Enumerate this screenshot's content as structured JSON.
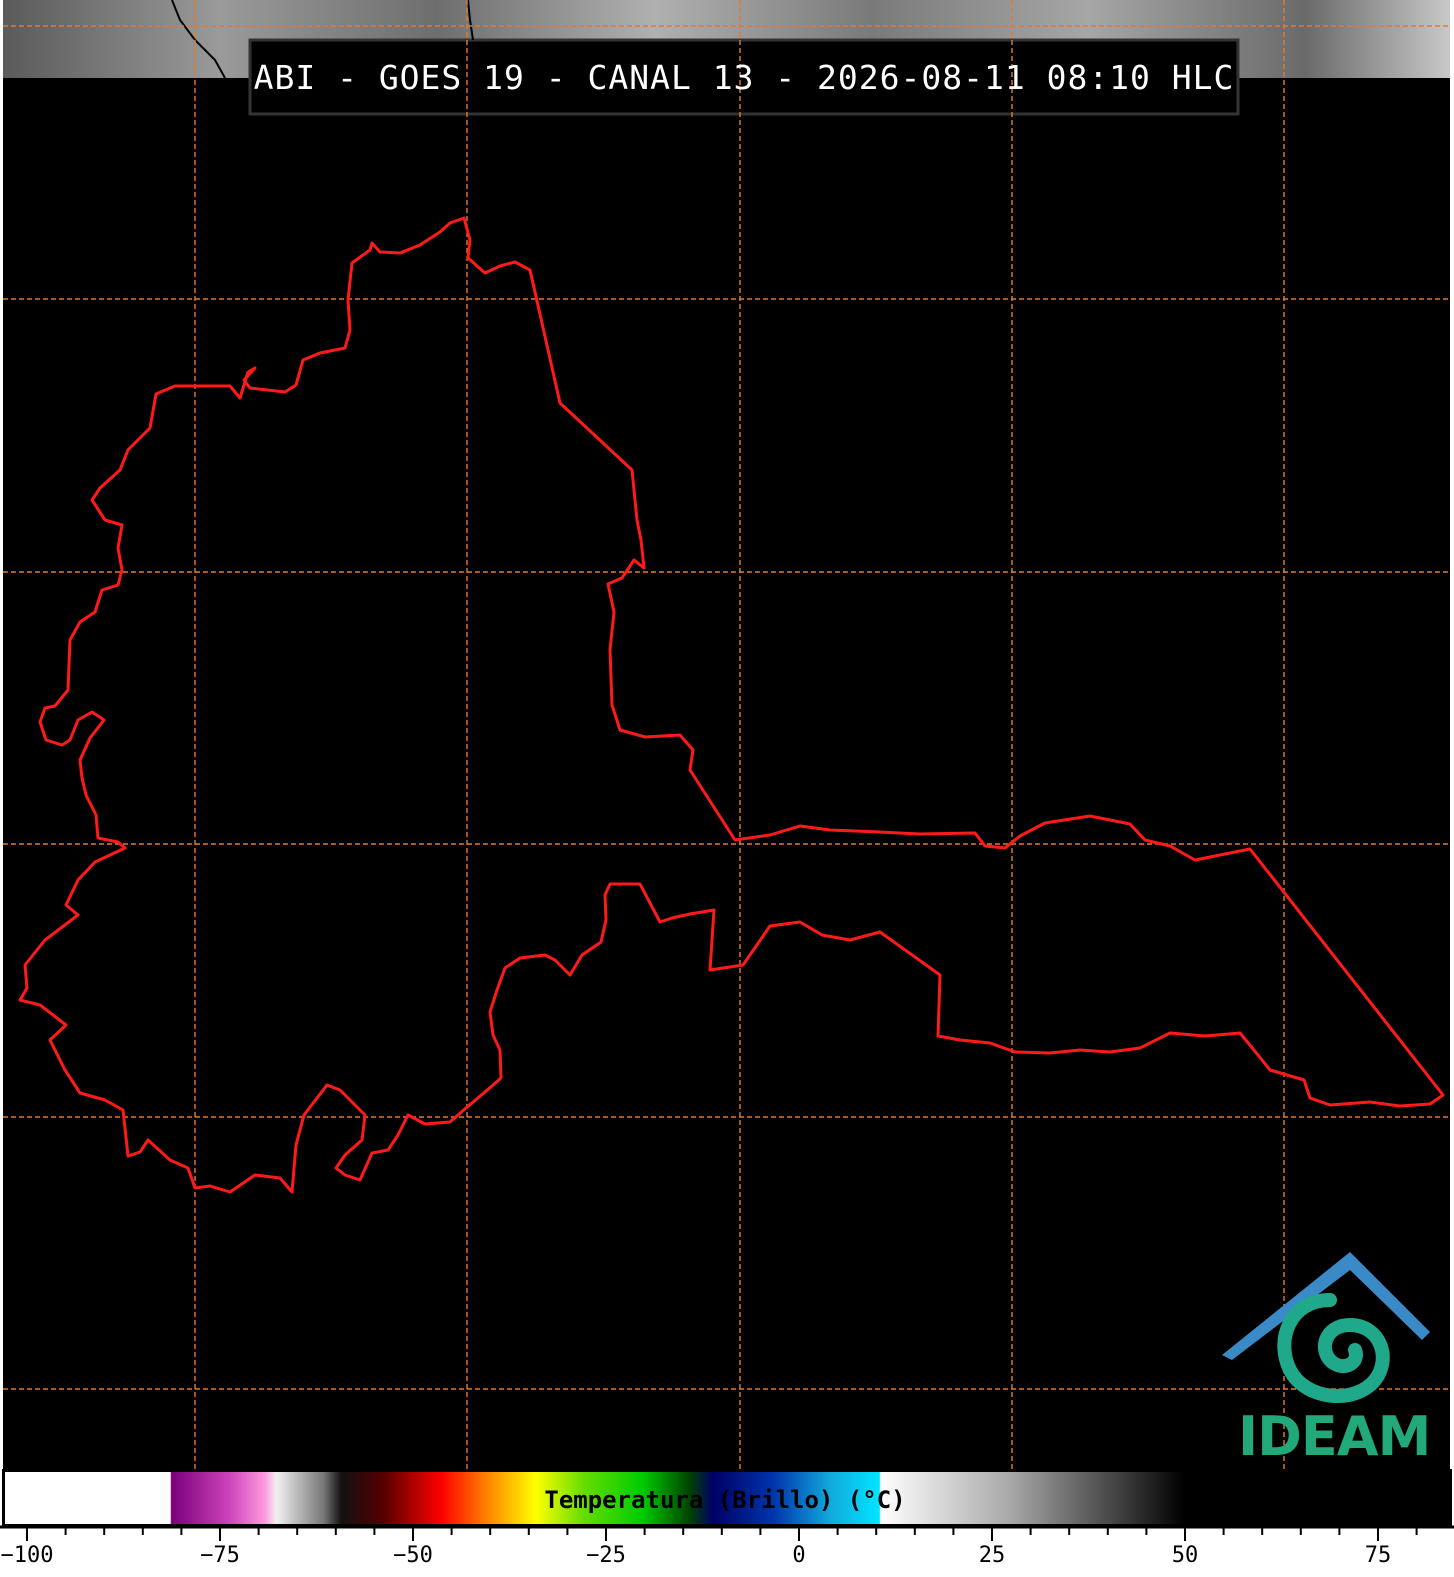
{
  "title": "ABI - GOES 19 - CANAL 13 - 2026-08-11 08:10 HLC",
  "logo": {
    "text": "IDEAM",
    "color": "#21a97a",
    "icon": "ideam-mountain-swirl-logo"
  },
  "map": {
    "background": "#000000",
    "boundary_color": "#ff1a1a",
    "graticule_color": "#e07a30"
  },
  "colorbar": {
    "label": "Temperatura (Brillo) (°C)",
    "min": -100,
    "max": 85,
    "ticks": [
      {
        "value": -100,
        "label": "−100"
      },
      {
        "value": -75,
        "label": "−75"
      },
      {
        "value": -50,
        "label": "−50"
      },
      {
        "value": -25,
        "label": "−25"
      },
      {
        "value": 0,
        "label": "0"
      },
      {
        "value": 25,
        "label": "25"
      },
      {
        "value": 50,
        "label": "50"
      },
      {
        "value": 75,
        "label": "75"
      }
    ]
  }
}
